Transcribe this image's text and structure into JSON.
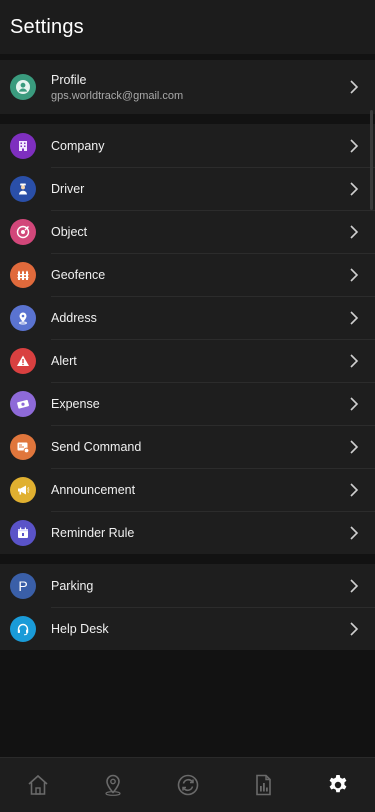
{
  "header": {
    "title": "Settings"
  },
  "profile": {
    "label": "Profile",
    "email": "gps.worldtrack@gmail.com"
  },
  "menu": [
    {
      "label": "Company"
    },
    {
      "label": "Driver"
    },
    {
      "label": "Object"
    },
    {
      "label": "Geofence"
    },
    {
      "label": "Address"
    },
    {
      "label": "Alert"
    },
    {
      "label": "Expense"
    },
    {
      "label": "Send Command"
    },
    {
      "label": "Announcement"
    },
    {
      "label": "Reminder Rule"
    }
  ],
  "menu2": [
    {
      "label": "Parking",
      "icon_text": "P"
    },
    {
      "label": "Help Desk"
    }
  ],
  "colors": {
    "profile": "#3a9b7e",
    "company": "#7e2fbf",
    "driver": "#2a4fa8",
    "object": "#d2477a",
    "geofence": "#e06a3c",
    "address": "#5a73d0",
    "alert": "#d94040",
    "expense": "#8e6ad8",
    "send_command": "#e0763c",
    "announcement": "#e0b030",
    "reminder_rule": "#5a53c8",
    "parking": "#3a5fa8",
    "help_desk": "#1a9bd8",
    "active_nav": "#ffffff",
    "inactive_nav": "#6a6a6a"
  },
  "bottom_nav": [
    {
      "icon": "home-icon",
      "active": false
    },
    {
      "icon": "location-pin-icon",
      "active": false
    },
    {
      "icon": "sync-icon",
      "active": false
    },
    {
      "icon": "reports-icon",
      "active": false
    },
    {
      "icon": "gear-icon",
      "active": true
    }
  ]
}
